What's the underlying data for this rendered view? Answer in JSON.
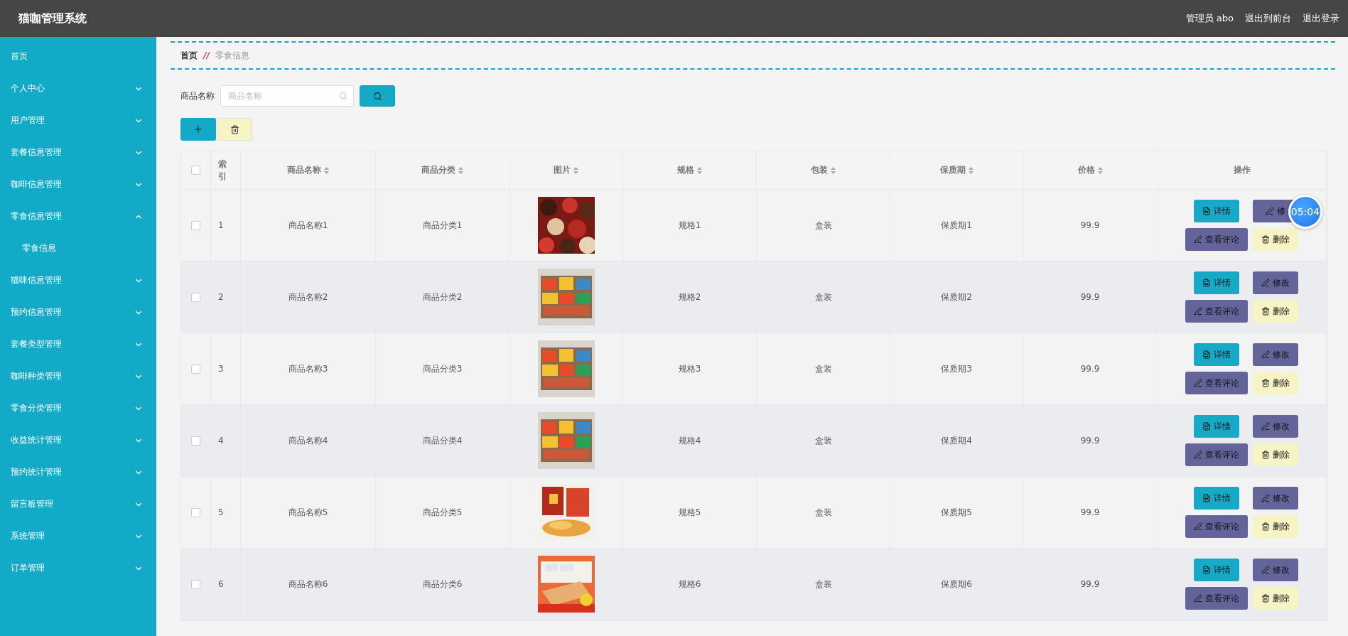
{
  "header": {
    "title": "猫咖管理系统",
    "links": [
      "管理员 abo",
      "退出到前台",
      "退出登录"
    ]
  },
  "sidebar": {
    "items": [
      {
        "label": "首页",
        "kind": "link"
      },
      {
        "label": "个人中心",
        "kind": "menu",
        "expanded": false
      },
      {
        "label": "用户管理",
        "kind": "menu",
        "expanded": false
      },
      {
        "label": "套餐信息管理",
        "kind": "menu",
        "expanded": false
      },
      {
        "label": "咖啡信息管理",
        "kind": "menu",
        "expanded": false
      },
      {
        "label": "零食信息管理",
        "kind": "menu",
        "expanded": true,
        "children": [
          {
            "label": "零食信息"
          }
        ]
      },
      {
        "label": "猫咪信息管理",
        "kind": "menu",
        "expanded": false
      },
      {
        "label": "预约信息管理",
        "kind": "menu",
        "expanded": false
      },
      {
        "label": "套餐类型管理",
        "kind": "menu",
        "expanded": false
      },
      {
        "label": "咖啡种类管理",
        "kind": "menu",
        "expanded": false
      },
      {
        "label": "零食分类管理",
        "kind": "menu",
        "expanded": false
      },
      {
        "label": "收益统计管理",
        "kind": "menu",
        "expanded": false
      },
      {
        "label": "预约统计管理",
        "kind": "menu",
        "expanded": false
      },
      {
        "label": "留言板管理",
        "kind": "menu",
        "expanded": false
      },
      {
        "label": "系统管理",
        "kind": "menu",
        "expanded": false
      },
      {
        "label": "订单管理",
        "kind": "menu",
        "expanded": false
      }
    ]
  },
  "breadcrumb": {
    "items": [
      "首页",
      "零食信息"
    ],
    "separator": "//"
  },
  "search": {
    "label": "商品名称",
    "placeholder": "商品名称"
  },
  "table": {
    "all_checked": false,
    "columns": [
      {
        "label": "索引",
        "sortable": false
      },
      {
        "label": "商品名称",
        "sortable": true
      },
      {
        "label": "商品分类",
        "sortable": true
      },
      {
        "label": "图片",
        "sortable": true
      },
      {
        "label": "规格",
        "sortable": true
      },
      {
        "label": "包装",
        "sortable": true
      },
      {
        "label": "保质期",
        "sortable": true
      },
      {
        "label": "价格",
        "sortable": true
      },
      {
        "label": "操作",
        "sortable": false
      }
    ],
    "rows": [
      {
        "checked": false,
        "index": "1",
        "name": "商品名称1",
        "category": "商品分类1",
        "spec": "规格1",
        "packing": "盒装",
        "shelf_life": "保质期1",
        "price": "99.9",
        "actions": [
          {
            "kind": "detail",
            "label": "详情"
          },
          {
            "kind": "edit",
            "label": "修"
          },
          {
            "kind": "comments",
            "label": "查看评论"
          },
          {
            "kind": "delete",
            "label": "删除"
          }
        ]
      },
      {
        "checked": false,
        "index": "2",
        "name": "商品名称2",
        "category": "商品分类2",
        "spec": "规格2",
        "packing": "盒装",
        "shelf_life": "保质期2",
        "price": "99.9",
        "actions": [
          {
            "kind": "detail",
            "label": "详情"
          },
          {
            "kind": "edit",
            "label": "修改"
          },
          {
            "kind": "comments",
            "label": "查看评论"
          },
          {
            "kind": "delete",
            "label": "删除"
          }
        ]
      },
      {
        "checked": false,
        "index": "3",
        "name": "商品名称3",
        "category": "商品分类3",
        "spec": "规格3",
        "packing": "盒装",
        "shelf_life": "保质期3",
        "price": "99.9",
        "actions": [
          {
            "kind": "detail",
            "label": "详情"
          },
          {
            "kind": "edit",
            "label": "修改"
          },
          {
            "kind": "comments",
            "label": "查看评论"
          },
          {
            "kind": "delete",
            "label": "删除"
          }
        ]
      },
      {
        "checked": false,
        "index": "4",
        "name": "商品名称4",
        "category": "商品分类4",
        "spec": "规格4",
        "packing": "盒装",
        "shelf_life": "保质期4",
        "price": "99.9",
        "actions": [
          {
            "kind": "detail",
            "label": "详情"
          },
          {
            "kind": "edit",
            "label": "修改"
          },
          {
            "kind": "comments",
            "label": "查看评论"
          },
          {
            "kind": "delete",
            "label": "删除"
          }
        ]
      },
      {
        "checked": false,
        "index": "5",
        "name": "商品名称5",
        "category": "商品分类5",
        "spec": "规格5",
        "packing": "盒装",
        "shelf_life": "保质期5",
        "price": "99.9",
        "actions": [
          {
            "kind": "detail",
            "label": "详情"
          },
          {
            "kind": "edit",
            "label": "修改"
          },
          {
            "kind": "comments",
            "label": "查看评论"
          },
          {
            "kind": "delete",
            "label": "删除"
          }
        ]
      },
      {
        "checked": false,
        "index": "6",
        "name": "商品名称6",
        "category": "商品分类6",
        "spec": "规格6",
        "packing": "盒装",
        "shelf_life": "保质期6",
        "price": "99.9",
        "actions": [
          {
            "kind": "detail",
            "label": "详情"
          },
          {
            "kind": "edit",
            "label": "修改"
          },
          {
            "kind": "comments",
            "label": "查看评论"
          },
          {
            "kind": "delete",
            "label": "删除"
          }
        ]
      }
    ]
  },
  "timer": "05:04"
}
